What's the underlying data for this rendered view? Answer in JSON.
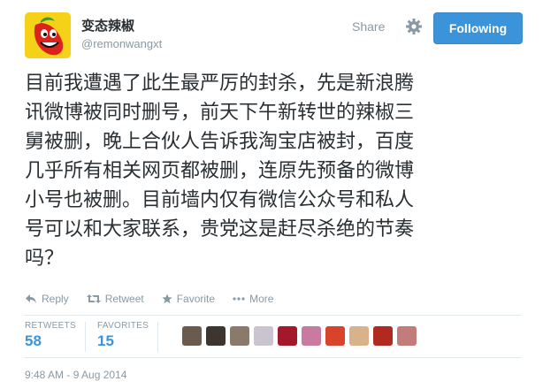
{
  "user": {
    "name": "变态辣椒",
    "handle": "@remonwangxt"
  },
  "header": {
    "share_label": "Share",
    "follow_label": "Following"
  },
  "tweet": {
    "lines": [
      "目前我遭遇了此生最严厉的封杀，先是新浪腾",
      "讯微博被同时删号，前天下午新转世的辣椒三",
      "舅被删，晚上合伙人告诉我淘宝店被封，百度",
      "几乎所有相关网页都被删，连原先预备的微博",
      "小号也被删。目前墙内仅有微信公众号和私人",
      "号可以和大家联系，贵党这是赶尽杀绝的节奏",
      "吗？"
    ]
  },
  "actions": {
    "reply": "Reply",
    "retweet": "Retweet",
    "favorite": "Favorite",
    "more": "More"
  },
  "stats": {
    "retweets_label": "RETWEETS",
    "retweets": "58",
    "favorites_label": "FAVORITES",
    "favorites": "15"
  },
  "favoriters": [
    {
      "color": "#6b5a4e"
    },
    {
      "color": "#3d3630"
    },
    {
      "color": "#8a7a6a"
    },
    {
      "color": "#c9c4d0"
    },
    {
      "color": "#a3182a"
    },
    {
      "color": "#c87aa0"
    },
    {
      "color": "#d9432b"
    },
    {
      "color": "#d8b28a"
    },
    {
      "color": "#b02a20"
    },
    {
      "color": "#c27c7c"
    }
  ],
  "timestamp": "9:48 AM - 9 Aug 2014",
  "colors": {
    "accent": "#3b94d9",
    "muted": "#8899a6",
    "text": "#292f33"
  }
}
